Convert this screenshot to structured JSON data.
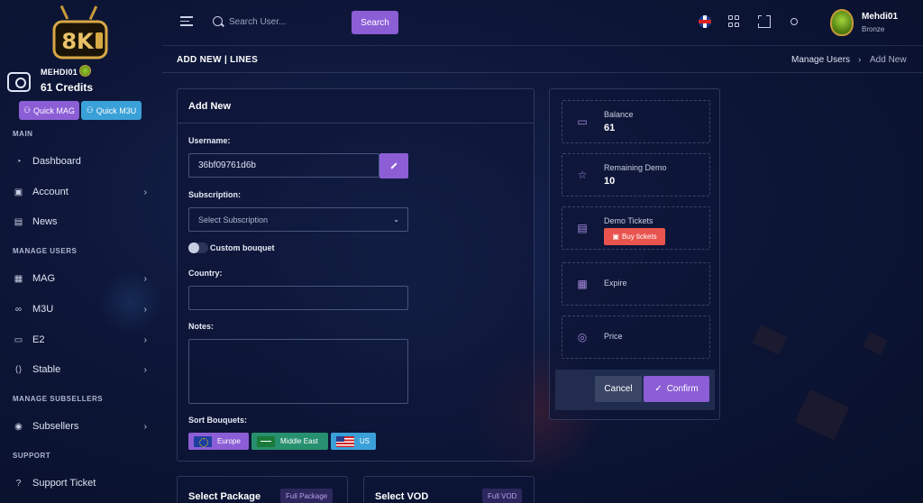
{
  "sidebar": {
    "logo_text": "8K",
    "user": {
      "name": "MEHDI01",
      "credits": "61 Credits"
    },
    "quick_mag": "Quick MAG",
    "quick_m3u": "Quick M3U",
    "sections": {
      "main": "MAIN",
      "manage_users": "MANAGE USERS",
      "manage_subsellers": "MANAGE SUBSELLERS",
      "support": "SUPPORT"
    },
    "items": {
      "dashboard": "Dashboard",
      "account": "Account",
      "news": "News",
      "mag": "MAG",
      "m3u": "M3U",
      "e2": "E2",
      "stable": "Stable",
      "subsellers": "Subsellers",
      "support_ticket": "Support Ticket"
    }
  },
  "topbar": {
    "search_placeholder": "Search User...",
    "search_button": "Search",
    "profile": {
      "name": "Mehdi01",
      "rank": "Bronze"
    }
  },
  "page": {
    "title": "ADD NEW | LINES",
    "breadcrumb": [
      "Manage Users",
      "›",
      "Add New"
    ]
  },
  "form": {
    "title": "Add New",
    "username_label": "Username:",
    "username_value": "36bf09761d6b",
    "subscription_label": "Subscription:",
    "subscription_placeholder": "Select Subscription",
    "custom_bouquet_label": "Custom bouquet",
    "country_label": "Country:",
    "notes_label": "Notes:",
    "sort_bouquets_label": "Sort Bouquets:",
    "bouquets": [
      "Europe",
      "Middle East",
      "US"
    ]
  },
  "stats": {
    "balance_label": "Balance",
    "balance_value": "61",
    "remaining_demo_label": "Remaining Demo",
    "remaining_demo_value": "10",
    "demo_tickets_label": "Demo Tickets",
    "buy_tickets": "Buy tickets",
    "expire_label": "Expire",
    "price_label": "Price",
    "cancel": "Cancel",
    "confirm": "Confirm"
  },
  "bottom": {
    "package_title": "Select Package",
    "package_tag": "Full Package",
    "vod_title": "Select VOD",
    "vod_tag": "Full VOD"
  },
  "colors": {
    "accent": "#8c5ed6",
    "info": "#3aa0d8",
    "danger": "#e9544f",
    "success": "#27906e",
    "background": "#0d1638"
  }
}
